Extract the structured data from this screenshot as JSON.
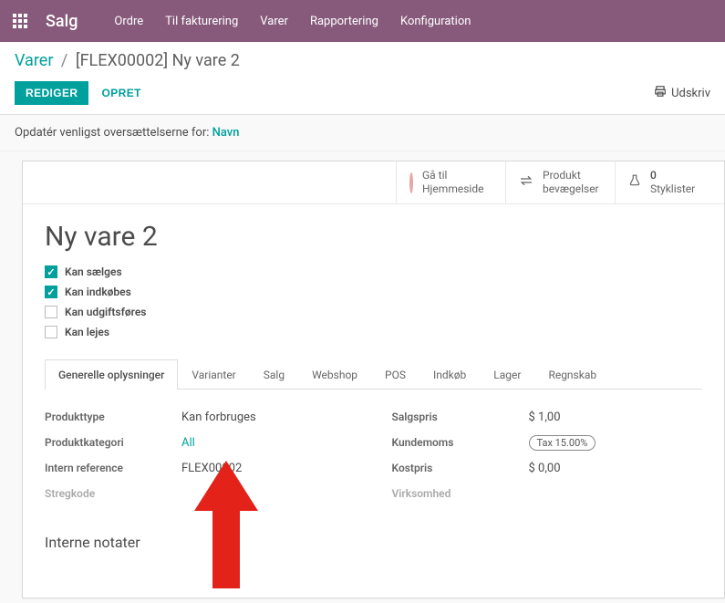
{
  "nav": {
    "brand": "Salg",
    "menu": [
      "Ordre",
      "Til fakturering",
      "Varer",
      "Rapportering",
      "Konfiguration"
    ]
  },
  "breadcrumb": {
    "root": "Varer",
    "current": "[FLEX00002] Ny vare 2"
  },
  "actions": {
    "edit": "REDIGER",
    "create": "OPRET",
    "print": "Udskriv"
  },
  "alert": {
    "text": "Opdatér venligst oversættelserne for: ",
    "link": "Navn"
  },
  "stat_buttons": [
    {
      "line1": "Gå til",
      "line2": "Hjemmeside",
      "icon": "globe"
    },
    {
      "line1": "Produkt",
      "line2": "bevægelser",
      "icon": "swap"
    },
    {
      "line1": "0",
      "line2": "Styklister",
      "icon": "flask"
    }
  ],
  "product": {
    "title": "Ny vare 2",
    "flags": [
      {
        "label": "Kan sælges",
        "checked": true
      },
      {
        "label": "Kan indkøbes",
        "checked": true
      },
      {
        "label": "Kan udgiftsføres",
        "checked": false
      },
      {
        "label": "Kan lejes",
        "checked": false
      }
    ]
  },
  "tabs": [
    "Generelle oplysninger",
    "Varianter",
    "Salg",
    "Webshop",
    "POS",
    "Indkøb",
    "Lager",
    "Regnskab"
  ],
  "general": {
    "left": [
      {
        "label": "Produkttype",
        "value": "Kan forbruges"
      },
      {
        "label": "Produktkategori",
        "value": "All",
        "link": true
      },
      {
        "label": "Intern reference",
        "value": "FLEX00002"
      },
      {
        "label": "Stregkode",
        "value": "",
        "muted": true
      }
    ],
    "right": [
      {
        "label": "Salgspris",
        "value": "$ 1,00"
      },
      {
        "label": "Kundemoms",
        "value": "Tax 15.00%",
        "tag": true
      },
      {
        "label": "Kostpris",
        "value": "$ 0,00"
      },
      {
        "label": "Virksomhed",
        "value": "",
        "muted": true
      }
    ]
  },
  "notes_heading": "Interne notater"
}
